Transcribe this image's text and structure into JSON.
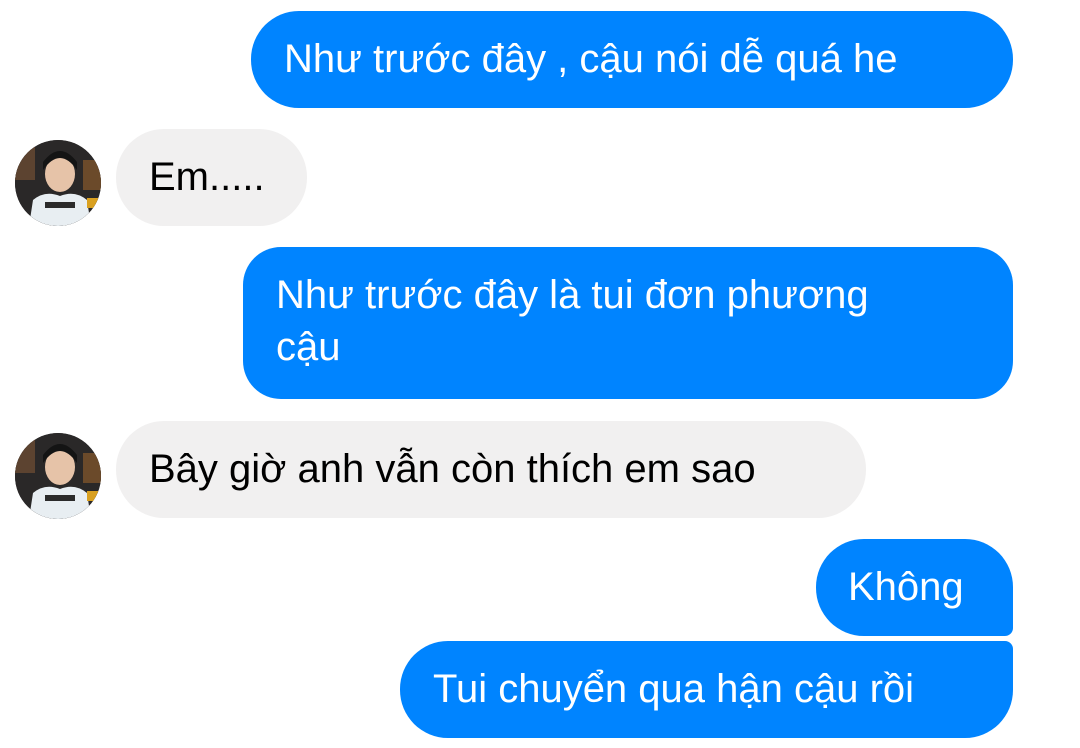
{
  "conversation": {
    "messages": [
      {
        "sender": "me",
        "text": "Như trước đây ,  cậu nói dễ quá he"
      },
      {
        "sender": "them",
        "text": "Em....."
      },
      {
        "sender": "me",
        "text": "Như trước đây là tui đơn phương cậu"
      },
      {
        "sender": "them",
        "text": "Bây giờ anh vẫn còn thích em sao"
      },
      {
        "sender": "me",
        "text": "Không"
      },
      {
        "sender": "me",
        "text": "Tui chuyển qua hận cậu rồi"
      }
    ]
  },
  "colors": {
    "outgoing_bubble": "#0084ff",
    "incoming_bubble": "#f1f0f0",
    "outgoing_text": "#ffffff",
    "incoming_text": "#000000"
  }
}
